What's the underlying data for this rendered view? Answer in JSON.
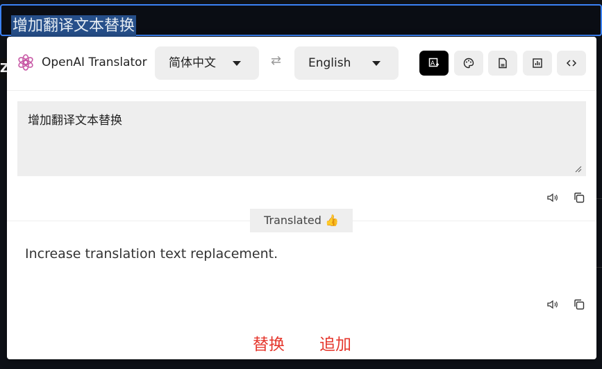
{
  "editor": {
    "selected_text": "增加翻译文本替换",
    "left_glyph": "Z."
  },
  "app": {
    "title": "OpenAI Translator",
    "source_language": "简体中文",
    "target_language": "English",
    "swap_glyph": "⇄"
  },
  "toolbar": {
    "buttons": [
      "translate-icon",
      "palette-icon",
      "document-icon",
      "chart-icon",
      "code-icon"
    ]
  },
  "source": {
    "text": "增加翻译文本替换"
  },
  "result": {
    "badge_label": "Translated",
    "badge_emoji": "👍",
    "text": "Increase translation text replacement."
  },
  "actions": {
    "replace_label": "替换",
    "append_label": "追加"
  },
  "colors": {
    "accent_selection": "#264f8a",
    "editor_border": "#3b82f6",
    "action_red": "#e5372d"
  }
}
